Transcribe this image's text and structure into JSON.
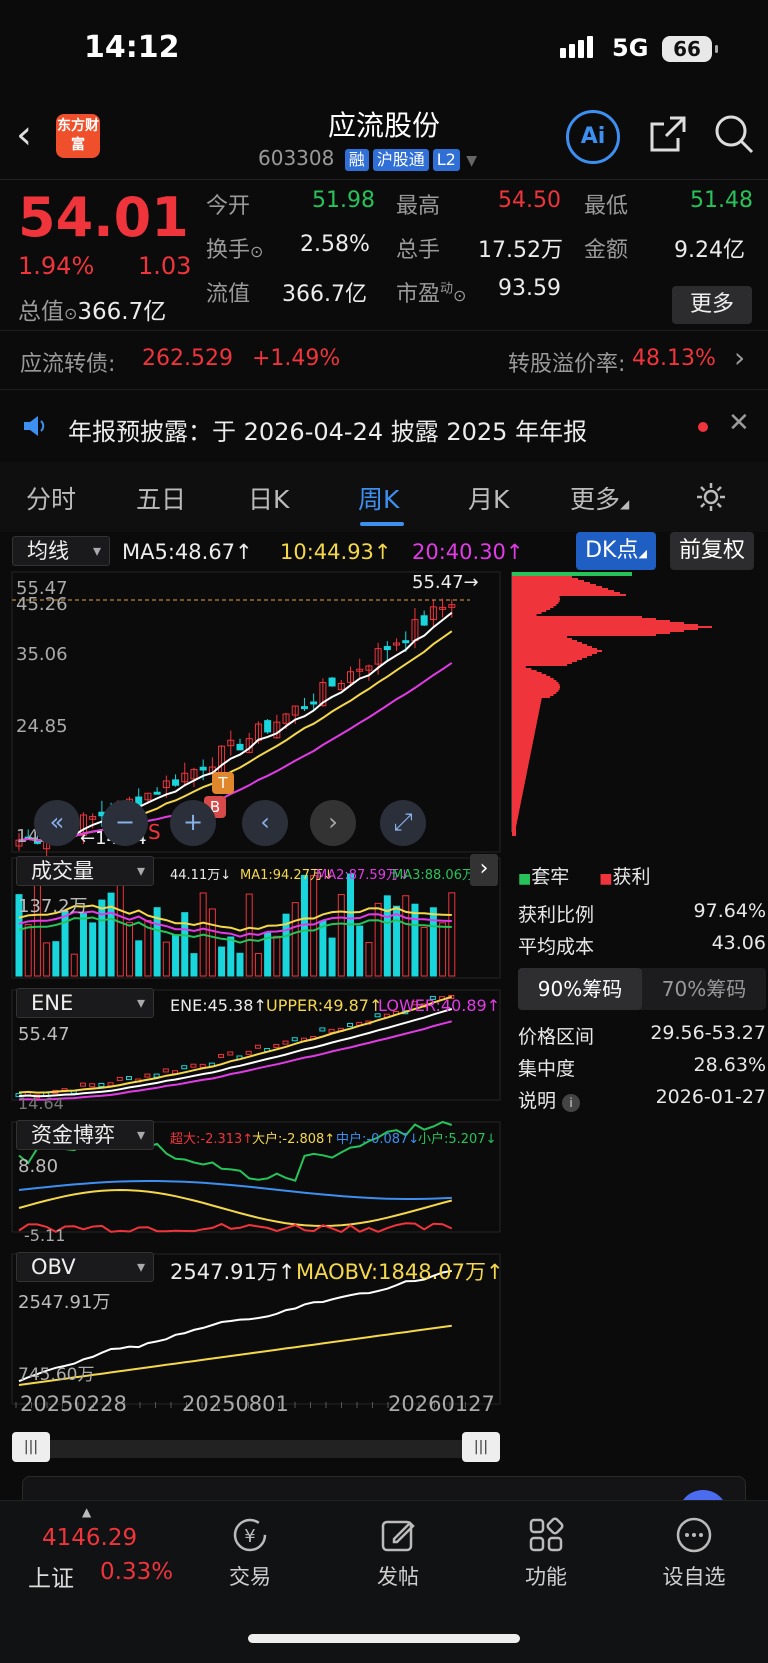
{
  "status": {
    "time": "14:12",
    "network": "5G",
    "battery": "66"
  },
  "header": {
    "title": "应流股份",
    "code": "603308",
    "tags": [
      "融",
      "沪股通",
      "L2"
    ],
    "logo_text": "东方财富",
    "ai_label": "Ai"
  },
  "quote": {
    "price": "54.01",
    "change_pct": "1.94%",
    "change": "1.03",
    "open_label": "今开",
    "open": "51.98",
    "high_label": "最高",
    "high": "54.50",
    "low_label": "最低",
    "low": "51.48",
    "turnover_label": "换手",
    "turnover": "2.58%",
    "volume_label": "总手",
    "volume": "17.52万",
    "amount_label": "金额",
    "amount": "9.24亿",
    "total_value_label": "总值",
    "total_value": "366.7亿",
    "float_value_label": "流值",
    "float_value": "366.7亿",
    "pe_label": "市盈",
    "pe_sup": "动",
    "pe": "93.59",
    "more_label": "更多"
  },
  "bond": {
    "label": "应流转债:",
    "price": "262.529",
    "pct": "+1.49%",
    "premium_label": "转股溢价率:",
    "premium": "48.13%"
  },
  "notice": {
    "text": "年报预披露：于 2026-04-24 披露 2025 年年报"
  },
  "tabs": [
    "分时",
    "五日",
    "日K",
    "周K",
    "月K",
    "更多"
  ],
  "active_tab": "周K",
  "kline": {
    "indicator": "均线",
    "ma5": "MA5:48.67↑",
    "ma10": "10:44.93↑",
    "ma20": "20:40.30↑",
    "dk_label": "DK点",
    "adjust_label": "前复权",
    "y_ticks": [
      "55.47",
      "45.26",
      "35.06",
      "24.85",
      "14.64"
    ],
    "high_mark": "55.47",
    "low_mark": "←14.64",
    "badges": [
      "T",
      "B",
      "S"
    ]
  },
  "volume": {
    "indicator": "成交量",
    "value": "44.11万↓",
    "ma1": "MA1:94.27万↓",
    "ma2": "MA2:87.59万↓",
    "ma3": "MA3:88.06万↓",
    "top": "137.2万"
  },
  "ene": {
    "indicator": "ENE",
    "ene": "ENE:45.38↑",
    "upper": "UPPER:49.87↑",
    "lower": "LOWER:40.89↑",
    "top": "55.47",
    "bottom": "14.64"
  },
  "fund": {
    "indicator": "资金博弈",
    "super": "超大:-2.313↑",
    "big": "大户:-2.808↑",
    "mid": "中户:-0.087↓",
    "small": "小户:5.207↓",
    "top": "8.80",
    "bottom": "-5.11"
  },
  "obv": {
    "indicator": "OBV",
    "obv": "2547.91万↑",
    "maobv": "MAOBV:1848.07万↑",
    "top": "2547.91万",
    "bottom": "745.60万"
  },
  "dates": [
    "20250228",
    "20250801",
    "20260127"
  ],
  "chips": {
    "legend_trap": "套牢",
    "legend_profit": "获利",
    "profit_ratio_label": "获利比例",
    "profit_ratio": "97.64%",
    "avg_cost_label": "平均成本",
    "avg_cost": "43.06",
    "seg_90": "90%筹码",
    "seg_70": "70%筹码",
    "range_label": "价格区间",
    "range": "29.56-53.27",
    "concentration_label": "集中度",
    "concentration": "28.63%",
    "note_label": "说明",
    "note_date": "2026-01-27"
  },
  "bottom_nav": {
    "index_value": "4146.29",
    "index_name": "上证",
    "index_pct": "0.33%",
    "items": [
      "交易",
      "发帖",
      "功能",
      "设自选"
    ]
  },
  "colors": {
    "up": "#f0343b",
    "down": "#27c35a",
    "accent": "#3d8ff0",
    "ma5": "#ffffff",
    "ma10": "#f5d84a",
    "ma20": "#e23be6",
    "cyan": "#18d6dc"
  }
}
